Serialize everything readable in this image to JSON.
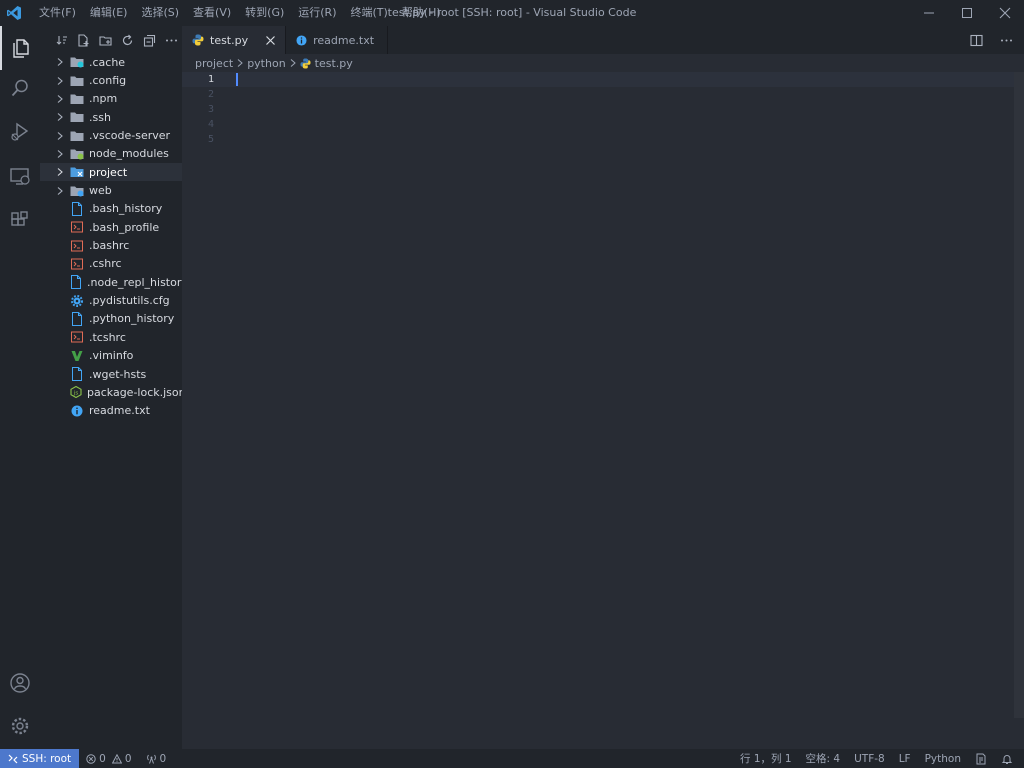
{
  "window": {
    "title": "test.py - root [SSH: root] - Visual Studio Code",
    "menu": [
      "文件(F)",
      "编辑(E)",
      "选择(S)",
      "查看(V)",
      "转到(G)",
      "运行(R)",
      "终端(T)",
      "帮助(H)"
    ]
  },
  "colors": {
    "accent": "#4d78cc",
    "background": "#282c34",
    "sidebar": "#21252b",
    "folder_icon": "#9da5b4",
    "shell_icon": "#e06c56",
    "python_blue": "#3d7ab5",
    "python_yellow": "#f2cd3a"
  },
  "explorer": {
    "items": [
      {
        "label": ".cache",
        "type": "folder",
        "icon": "folder-cache-icon"
      },
      {
        "label": ".config",
        "type": "folder",
        "icon": "folder-icon"
      },
      {
        "label": ".npm",
        "type": "folder",
        "icon": "folder-icon"
      },
      {
        "label": ".ssh",
        "type": "folder",
        "icon": "folder-icon"
      },
      {
        "label": ".vscode-server",
        "type": "folder",
        "icon": "folder-icon"
      },
      {
        "label": "node_modules",
        "type": "folder",
        "icon": "folder-node-icon"
      },
      {
        "label": "project",
        "type": "folder",
        "icon": "folder-project-icon",
        "selected": true
      },
      {
        "label": "web",
        "type": "folder",
        "icon": "folder-web-icon"
      },
      {
        "label": ".bash_history",
        "type": "file",
        "icon": "file-icon"
      },
      {
        "label": ".bash_profile",
        "type": "file",
        "icon": "shell-icon"
      },
      {
        "label": ".bashrc",
        "type": "file",
        "icon": "shell-icon"
      },
      {
        "label": ".cshrc",
        "type": "file",
        "icon": "shell-icon"
      },
      {
        "label": ".node_repl_history",
        "type": "file",
        "icon": "file-icon"
      },
      {
        "label": ".pydistutils.cfg",
        "type": "file",
        "icon": "gear-icon"
      },
      {
        "label": ".python_history",
        "type": "file",
        "icon": "file-icon"
      },
      {
        "label": ".tcshrc",
        "type": "file",
        "icon": "shell-icon"
      },
      {
        "label": ".viminfo",
        "type": "file",
        "icon": "vim-icon"
      },
      {
        "label": ".wget-hsts",
        "type": "file",
        "icon": "file-icon"
      },
      {
        "label": "package-lock.json",
        "type": "file",
        "icon": "node-icon"
      },
      {
        "label": "readme.txt",
        "type": "file",
        "icon": "info-icon"
      }
    ]
  },
  "tabs": [
    {
      "label": "test.py",
      "active": true,
      "icon": "python-icon"
    },
    {
      "label": "readme.txt",
      "active": false,
      "icon": "info-icon"
    }
  ],
  "breadcrumb": [
    "project",
    "python",
    "test.py"
  ],
  "editor": {
    "line_numbers": [
      "1",
      "2",
      "3",
      "4",
      "5"
    ],
    "current_line": 1
  },
  "status": {
    "remote": "SSH: root",
    "errors": "0",
    "warnings": "0",
    "ports": "0",
    "position": "行 1，列 1",
    "spaces": "空格: 4",
    "encoding": "UTF-8",
    "eol": "LF",
    "language": "Python"
  }
}
